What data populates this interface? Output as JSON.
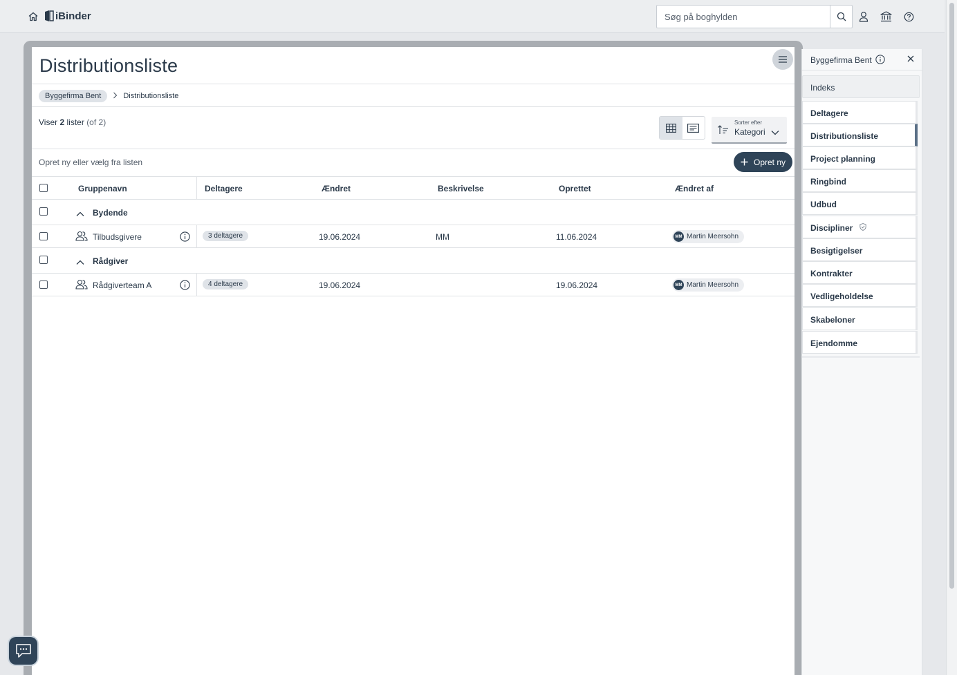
{
  "header": {
    "brand": "iBinder",
    "search_placeholder": "Søg på boghylden"
  },
  "page": {
    "title": "Distributionsliste",
    "breadcrumb": [
      "Byggefirma Bent",
      "Distributionsliste"
    ],
    "count": {
      "prefix": "Viser",
      "number": "2",
      "unit": "lister",
      "suffix": "(of 2)"
    },
    "hint": "Opret ny eller vælg fra listen",
    "new_button": "Opret ny",
    "sort": {
      "label": "Sorter efter",
      "value": "Kategori"
    }
  },
  "table": {
    "columns": [
      "Gruppenavn",
      "Deltagere",
      "Ændret",
      "Beskrivelse",
      "Oprettet",
      "Ændret af"
    ],
    "groups": [
      {
        "name": "Bydende",
        "rows": [
          {
            "name": "Tilbudsgivere",
            "participants": "3 deltagere",
            "changed": "19.06.2024",
            "description": "MM",
            "created": "11.06.2024",
            "changed_by": "Martin Meersohn",
            "initials": "MM"
          }
        ]
      },
      {
        "name": "Rådgiver",
        "rows": [
          {
            "name": "Rådgiverteam A",
            "participants": "4 deltagere",
            "changed": "19.06.2024",
            "description": "",
            "created": "19.06.2024",
            "changed_by": "Martin Meersohn",
            "initials": "MM"
          }
        ]
      }
    ]
  },
  "index_panel": {
    "title": "Byggefirma Bent",
    "indeks": "Indeks",
    "items": [
      "Deltagere",
      "Distributionsliste",
      "Project planning",
      "Ringbind",
      "Udbud",
      "Discipliner",
      "Besigtigelser",
      "Kontrakter",
      "Vedligeholdelse",
      "Skabeloner",
      "Ejendomme"
    ],
    "active_item": "Distributionsliste"
  },
  "colors": {
    "accent": "#2f4458",
    "pill": "#dfe3e8",
    "divider": "#dfe2e5"
  }
}
